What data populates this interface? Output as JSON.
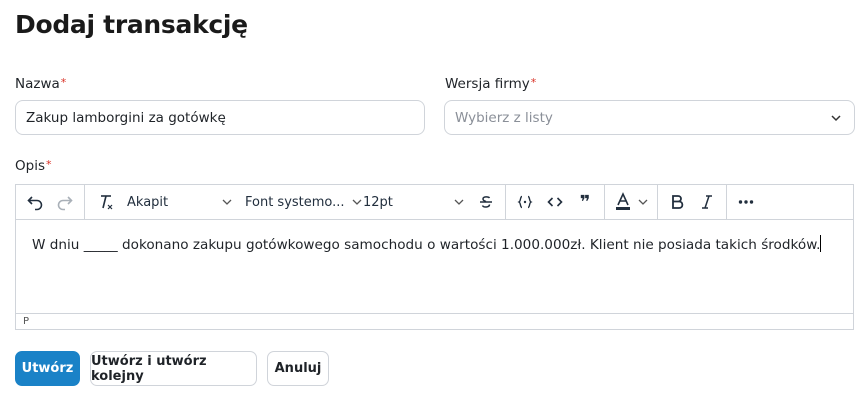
{
  "page": {
    "title": "Dodaj transakcję"
  },
  "form": {
    "name": {
      "label": "Nazwa",
      "required_mark": "*",
      "value": "Zakup lamborgini za gotówkę"
    },
    "company_version": {
      "label": "Wersja firmy",
      "required_mark": "*",
      "placeholder": "Wybierz z listy"
    },
    "description": {
      "label": "Opis",
      "required_mark": "*"
    }
  },
  "editor": {
    "toolbar": {
      "block_format": "Akapit",
      "font_family": "Font systemo...",
      "font_size": "12pt",
      "blockquote_glyph": "❞"
    },
    "content": "W dniu _____ dokonano zakupu gotówkowego samochodu o wartości 1.000.000zł. Klient nie posiada takich środków.",
    "status_path": "P"
  },
  "actions": {
    "create": "Utwórz",
    "create_and_next": "Utwórz i utwórz kolejny",
    "cancel": "Anuluj"
  },
  "colors": {
    "primary": "#1a82c7",
    "required": "#d93025",
    "border": "#d0d4da"
  }
}
